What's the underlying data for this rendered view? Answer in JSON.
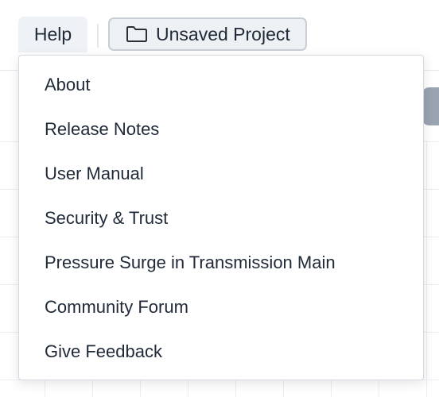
{
  "menubar": {
    "help_label": "Help",
    "project_label": "Unsaved Project",
    "project_icon": "folder-icon"
  },
  "help_menu": {
    "items": [
      {
        "label": "About"
      },
      {
        "label": "Release Notes"
      },
      {
        "label": "User Manual"
      },
      {
        "label": "Security & Trust"
      },
      {
        "label": "Pressure Surge in Transmission Main"
      },
      {
        "label": "Community Forum"
      },
      {
        "label": "Give Feedback"
      }
    ]
  },
  "colors": {
    "menu_active_bg": "#eef2f6",
    "text": "#1f2937",
    "border": "#d6dae0",
    "grid_line": "#eceef1"
  }
}
